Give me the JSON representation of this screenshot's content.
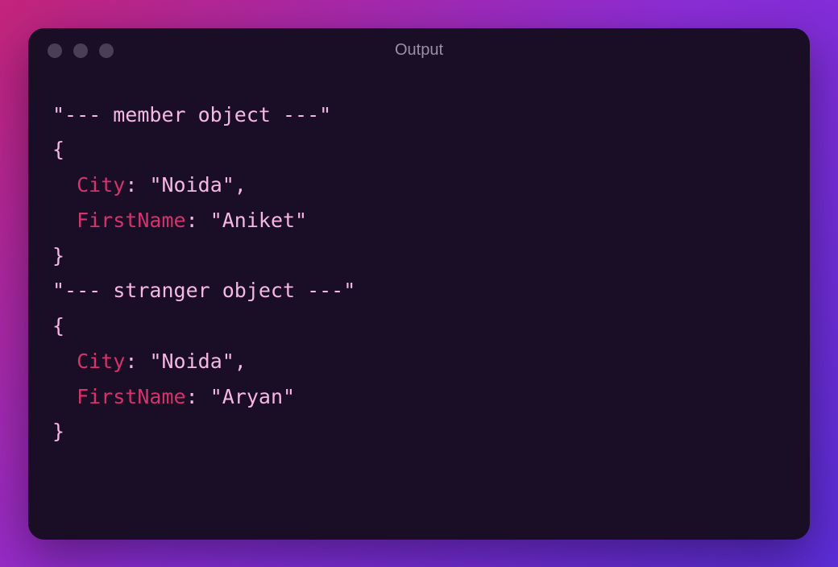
{
  "window": {
    "title": "Output"
  },
  "output": {
    "section1_label": "\"--- member object ---\"",
    "open_brace": "{",
    "close_brace": "}",
    "key_city": "City",
    "key_firstname": "FirstName",
    "colon": ":",
    "comma": ",",
    "member_city": "\"Noida\"",
    "member_firstname": "\"Aniket\"",
    "section2_label": "\"--- stranger object ---\"",
    "stranger_city": "\"Noida\"",
    "stranger_firstname": "\"Aryan\""
  }
}
